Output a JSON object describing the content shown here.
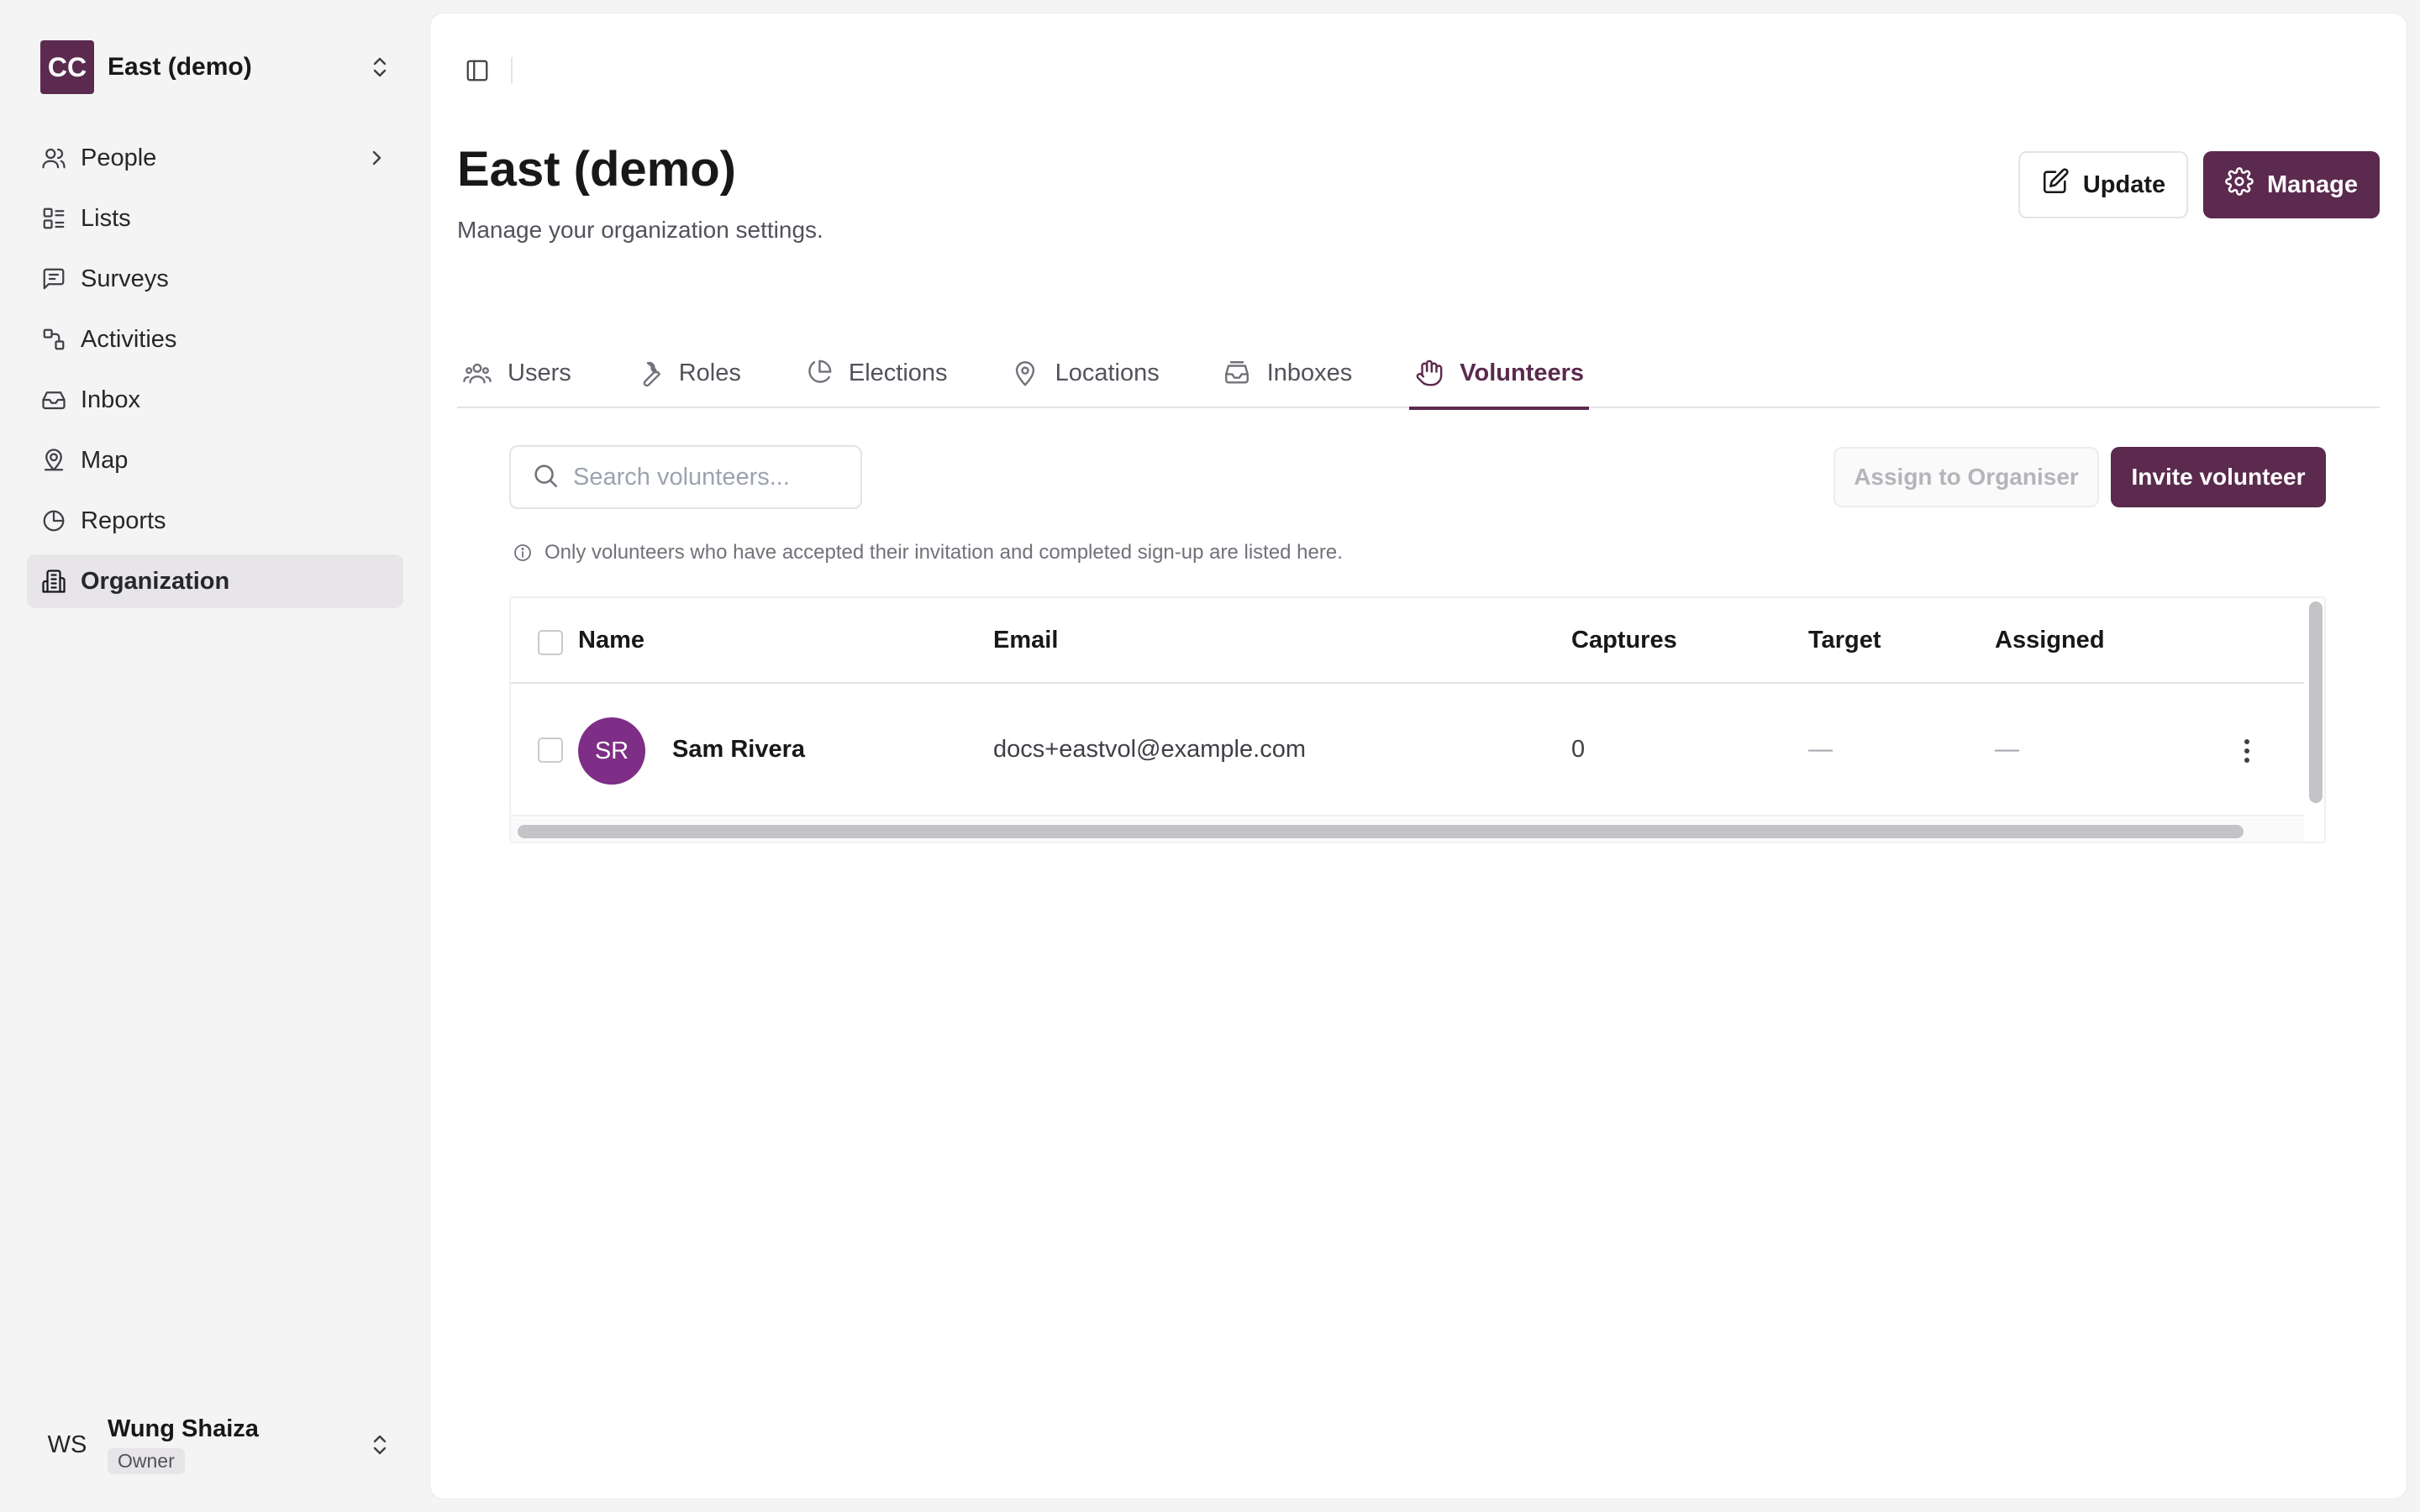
{
  "org": {
    "logo_text": "CC",
    "name": "East (demo)"
  },
  "sidebar": {
    "items": [
      {
        "label": "People",
        "icon": "people-icon",
        "has_chevron": true
      },
      {
        "label": "Lists",
        "icon": "list-icon"
      },
      {
        "label": "Surveys",
        "icon": "survey-icon"
      },
      {
        "label": "Activities",
        "icon": "activities-icon"
      },
      {
        "label": "Inbox",
        "icon": "inbox-icon"
      },
      {
        "label": "Map",
        "icon": "map-icon"
      },
      {
        "label": "Reports",
        "icon": "reports-icon"
      },
      {
        "label": "Organization",
        "icon": "organization-icon",
        "active": true
      }
    ]
  },
  "user": {
    "initials": "WS",
    "name": "Wung Shaiza",
    "role": "Owner"
  },
  "page": {
    "title": "East (demo)",
    "subtitle": "Manage your organization settings.",
    "update_label": "Update",
    "manage_label": "Manage"
  },
  "tabs": [
    {
      "label": "Users",
      "icon": "users-icon"
    },
    {
      "label": "Roles",
      "icon": "wrench-icon"
    },
    {
      "label": "Elections",
      "icon": "pie-chart-icon"
    },
    {
      "label": "Locations",
      "icon": "map-pin-icon"
    },
    {
      "label": "Inboxes",
      "icon": "inboxes-icon"
    },
    {
      "label": "Volunteers",
      "icon": "hand-icon",
      "active": true
    }
  ],
  "volunteers": {
    "search_placeholder": "Search volunteers...",
    "assign_label": "Assign to Organiser",
    "invite_label": "Invite volunteer",
    "note": "Only volunteers who have accepted their invitation and completed sign-up are listed here.",
    "columns": {
      "name": "Name",
      "email": "Email",
      "captures": "Captures",
      "target": "Target",
      "assigned": "Assigned"
    },
    "rows": [
      {
        "initials": "SR",
        "name": "Sam Rivera",
        "email": "docs+eastvol@example.com",
        "captures": "0",
        "target": "—",
        "assigned": "—"
      }
    ]
  },
  "colors": {
    "accent": "#5b2a4e",
    "avatar": "#7e2e86"
  }
}
